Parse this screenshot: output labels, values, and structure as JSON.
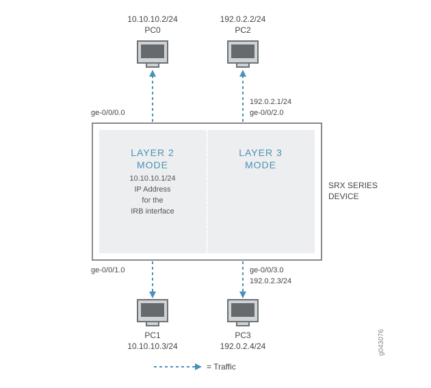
{
  "pc0": {
    "ip": "10.10.10.2/24",
    "name": "PC0"
  },
  "pc2": {
    "ip": "192.0.2.2/24",
    "name": "PC2"
  },
  "iface_top_left": "ge-0/0/0.0",
  "iface_top_right_ip": "192.0.2.1/24",
  "iface_top_right": "ge-0/0/2.0",
  "iface_bot_left": "ge-0/0/1.0",
  "iface_bot_right": "ge-0/0/3.0",
  "iface_bot_right_ip": "192.0.2.3/24",
  "layer2": {
    "title1": "LAYER 2",
    "title2": "MODE",
    "ip": "10.10.10.1/24",
    "desc1": "IP Address",
    "desc2": "for the",
    "desc3": "IRB interface"
  },
  "layer3": {
    "title1": "LAYER 3",
    "title2": "MODE"
  },
  "device_label1": "SRX SERIES",
  "device_label2": "DEVICE",
  "pc1": {
    "name": "PC1",
    "ip": "10.10.10.3/24"
  },
  "pc3": {
    "name": "PC3",
    "ip": "192.0.2.4/24"
  },
  "legend": "= Traffic",
  "figid": "g043076"
}
